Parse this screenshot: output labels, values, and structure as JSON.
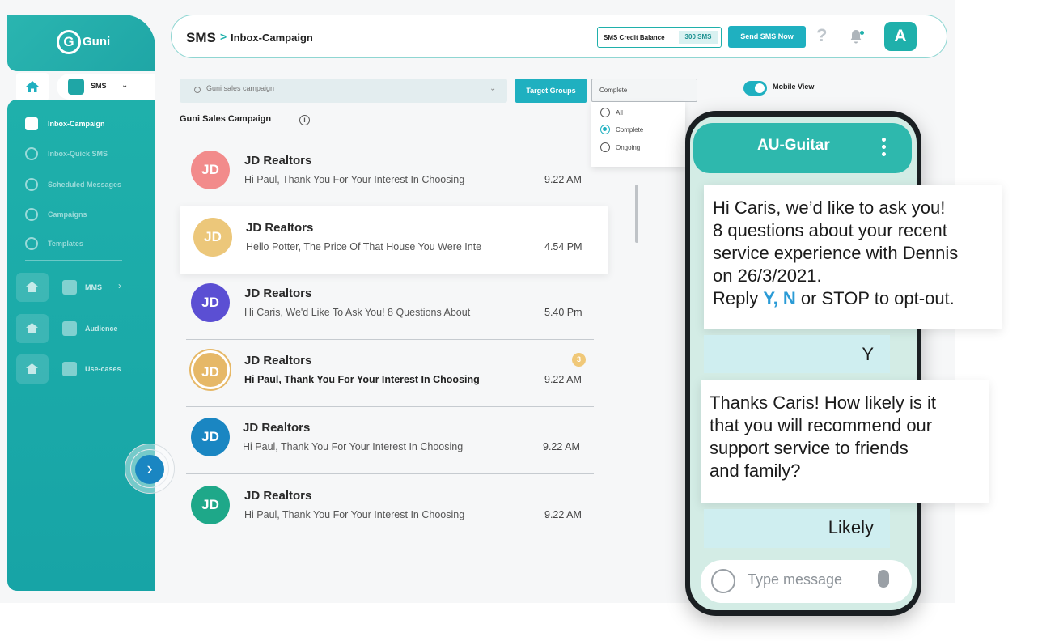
{
  "brand": {
    "name": "Guni",
    "mark": "G"
  },
  "sidebar": {
    "product_label": "SMS",
    "items": [
      {
        "label": "Inbox-Campaign",
        "active": true
      },
      {
        "label": "Inbox-Quick SMS",
        "active": false
      },
      {
        "label": "Scheduled Messages",
        "active": false
      },
      {
        "label": "Campaigns",
        "active": false
      },
      {
        "label": "Templates",
        "active": false
      }
    ],
    "groups": [
      {
        "label": "MMS",
        "arrow": "›"
      },
      {
        "label": "Audience",
        "arrow": ""
      },
      {
        "label": "Use-cases",
        "arrow": ""
      }
    ],
    "collapse_arrow": "›"
  },
  "header": {
    "breadcrumb_root": "SMS",
    "breadcrumb_sep": ">",
    "breadcrumb_page": "Inbox-Campaign",
    "credit_label": "SMS Credit Balance",
    "credit_value": "300 SMS",
    "send_label": "Send SMS Now",
    "help": "?",
    "avatar": "A"
  },
  "filters": {
    "search_value": "Guni sales campaign",
    "search_chevron": "⌄",
    "target_groups": "Target Groups",
    "status_value": "Complete",
    "status_options": [
      "All",
      "Complete",
      "Ongoing"
    ],
    "mobile_view_label": "Mobile View"
  },
  "campaign": {
    "title": "Guni Sales Campaign",
    "info": "i"
  },
  "conversations": [
    {
      "initials": "JD",
      "name": "JD Realtors",
      "preview": "Hi Paul, Thank You For Your Interest In Choosing",
      "time": "9.22 AM",
      "color": "#f28b8b"
    },
    {
      "initials": "JD",
      "name": "JD Realtors",
      "preview": "Hello Potter,  The Price Of That House You Were Inte",
      "time": "4.54 PM",
      "color": "#ecc77a"
    },
    {
      "initials": "JD",
      "name": "JD Realtors",
      "preview": "Hi Caris, We'd Like To Ask You! 8 Questions About",
      "time": "5.40 Pm",
      "color": "#5b4fd3"
    },
    {
      "initials": "JD",
      "name": "JD Realtors",
      "preview": "Hi Paul, Thank You For Your Interest In Choosing",
      "time": "9.22 AM",
      "color": "#e6b867",
      "badge": "3"
    },
    {
      "initials": "JD",
      "name": "JD Realtors",
      "preview": "Hi Paul, Thank You For Your Interest In Choosing",
      "time": "9.22 AM",
      "color": "#1a86c2"
    },
    {
      "initials": "JD",
      "name": "JD Realtors",
      "preview": "Hi Paul, Thank You For Your Interest In Choosing",
      "time": "9.22 AM",
      "color": "#1ea889"
    }
  ],
  "phone": {
    "contact": "AU-Guitar",
    "msg1_lines": [
      "Hi Caris, we’d like to ask you!",
      "8 questions about your recent",
      "service experience with Dennis",
      "on 26/3/2021."
    ],
    "msg1_reply_pre": "Reply ",
    "msg1_reply_hl": "Y, N",
    "msg1_reply_post": "  or STOP to opt-out.",
    "reply1": "Y",
    "msg2_lines": [
      "Thanks Caris! How likely is it",
      "that you will recommend our",
      "support service to friends",
      "and family?"
    ],
    "reply2": "Likely",
    "input_placeholder": "Type message"
  }
}
